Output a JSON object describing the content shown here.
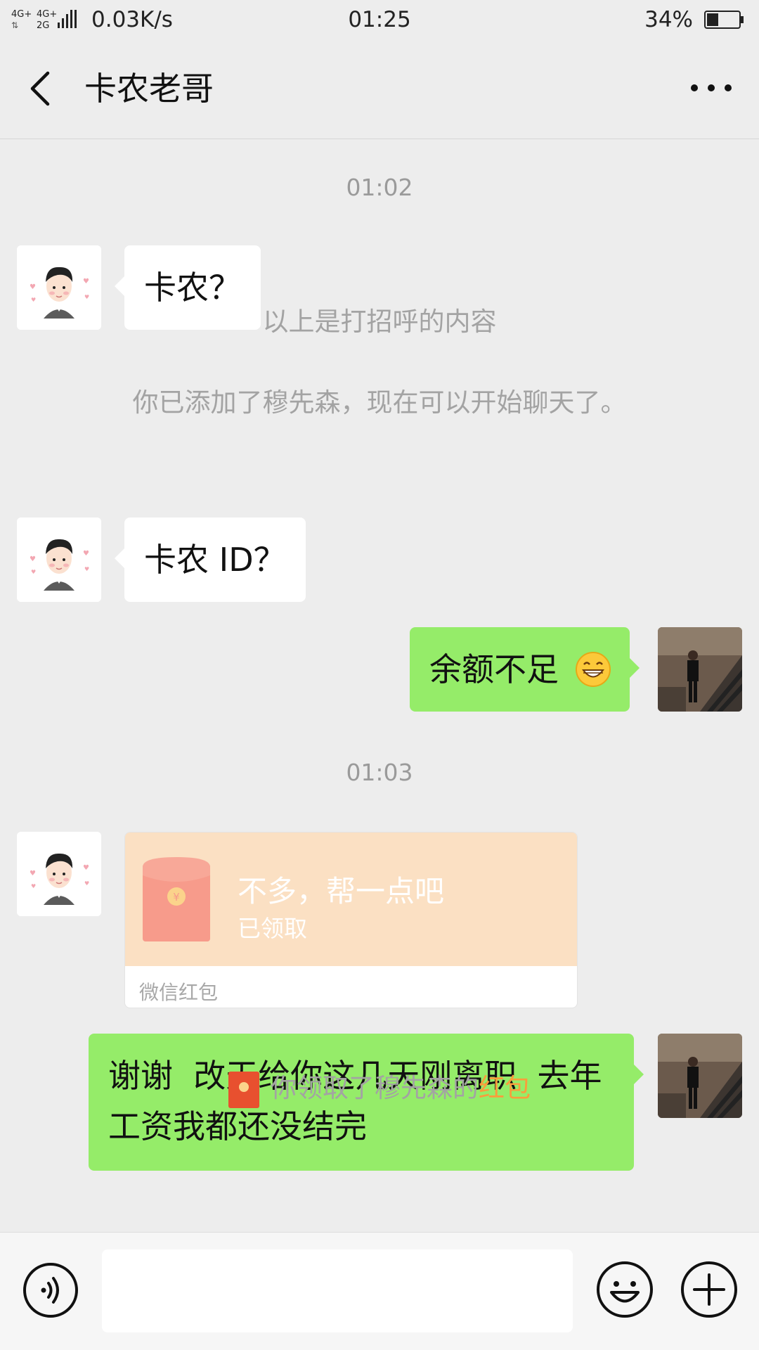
{
  "status_bar": {
    "network": "4G⁺ 4G⁺ 2G",
    "speed": "0.03K/s",
    "time": "01:25",
    "battery": "34%"
  },
  "header": {
    "title": "卡农老哥"
  },
  "messages": {
    "ts1": "01:02",
    "m1": "卡农？",
    "sys1": "以上是打招呼的内容",
    "sys2": "你已添加了穆先森，现在可以开始聊天了。",
    "m2": "卡农 ID？",
    "m3": "余额不足",
    "ts2": "01:03",
    "redpacket": {
      "title": "不多，帮一点吧",
      "status": "已领取",
      "footer": "微信红包"
    },
    "m4": "谢谢  改天给你这几天刚离职  去年工资我都还没结完",
    "notice_prefix": "你领取了穆先森的",
    "notice_link": "红包"
  },
  "colors": {
    "background": "#ededed",
    "sent_bubble": "#95ec69",
    "received_bubble": "#ffffff",
    "red_packet": "#fbe0c3",
    "accent": "#fa9d3b"
  },
  "icons": {
    "back": "chevron-left-icon",
    "more": "more-dots-icon",
    "voice": "voice-icon",
    "emoji": "emoji-icon",
    "plus": "plus-icon"
  }
}
